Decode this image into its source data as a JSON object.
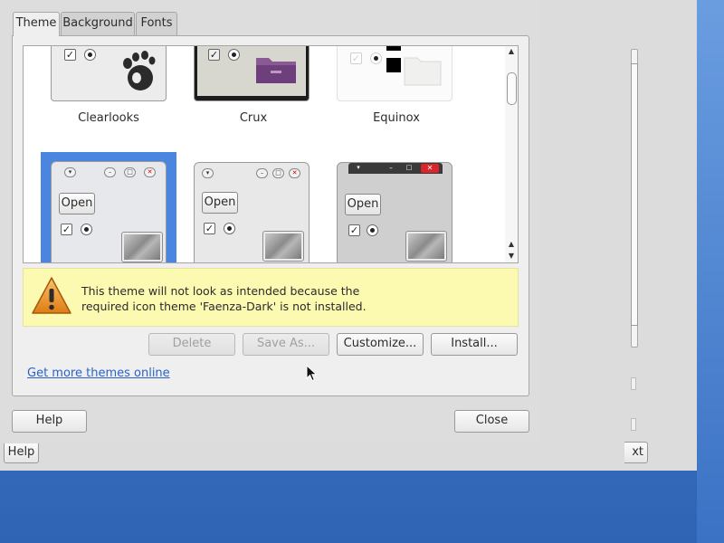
{
  "tabs": [
    {
      "label": "Theme",
      "active": true
    },
    {
      "label": "Background",
      "active": false
    },
    {
      "label": "Fonts",
      "active": false
    }
  ],
  "themes_row1": [
    {
      "name": "Clearlooks"
    },
    {
      "name": "Crux"
    },
    {
      "name": "Equinox"
    }
  ],
  "themes_row2": [
    {
      "open_label": "Open",
      "selected": true
    },
    {
      "open_label": "Open",
      "selected": false
    },
    {
      "open_label": "Open",
      "selected": false
    }
  ],
  "warning": {
    "line1": "This theme will not look as intended because the",
    "line2": "required icon theme 'Faenza-Dark' is not installed."
  },
  "actions": {
    "delete": "Delete",
    "save_as": "Save As...",
    "customize": "Customize...",
    "install": "Install..."
  },
  "link": {
    "get_more": "Get more themes online"
  },
  "footer": {
    "help": "Help",
    "close": "Close"
  },
  "bg_window": {
    "help": "Help",
    "next_partial": "xt"
  },
  "colors": {
    "selection": "#4a86e0",
    "warning_bg": "#fcf9b0",
    "link": "#2a62c4",
    "desktop": "#3d74c5"
  }
}
